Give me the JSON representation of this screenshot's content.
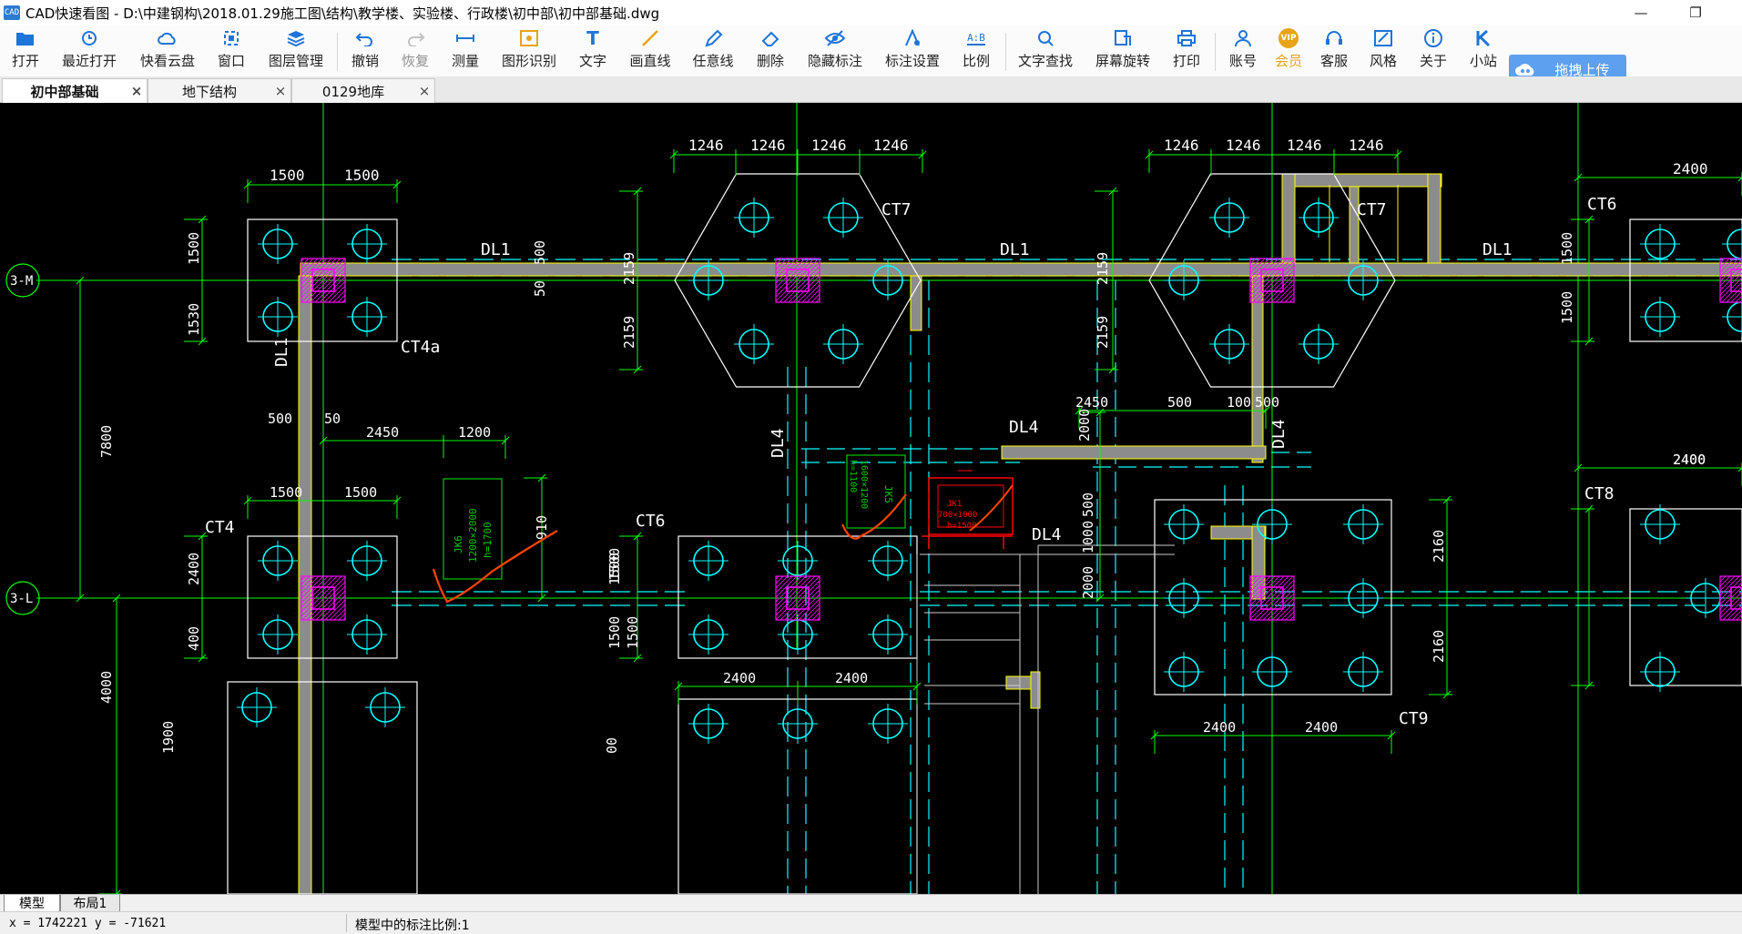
{
  "window": {
    "app_icon_text": "CAD",
    "title": "CAD快速看图 - D:\\中建钢构\\2018.01.29施工图\\结构\\教学楼、实验楼、行政楼\\初中部\\初中部基础.dwg",
    "minimize_glyph": "—",
    "restore_glyph": "❐"
  },
  "toolbar": {
    "items": [
      {
        "label": "打开",
        "icon": "folder-icon"
      },
      {
        "label": "最近打开",
        "icon": "history-icon"
      },
      {
        "label": "快看云盘",
        "icon": "cloud-icon"
      },
      {
        "label": "窗口",
        "icon": "window-icon"
      },
      {
        "label": "图层管理",
        "icon": "layers-icon"
      },
      {
        "label": "撤销",
        "icon": "undo-icon"
      },
      {
        "label": "恢复",
        "icon": "redo-icon"
      },
      {
        "label": "测量",
        "icon": "measure-icon"
      },
      {
        "label": "图形识别",
        "icon": "recognize-icon"
      },
      {
        "label": "文字",
        "icon": "text-icon"
      },
      {
        "label": "画直线",
        "icon": "line-icon"
      },
      {
        "label": "任意线",
        "icon": "pen-icon"
      },
      {
        "label": "删除",
        "icon": "eraser-icon"
      },
      {
        "label": "隐藏标注",
        "icon": "eye-hide-icon"
      },
      {
        "label": "标注设置",
        "icon": "annotation-settings-icon"
      },
      {
        "label": "比例",
        "icon": "scale-icon"
      },
      {
        "label": "文字查找",
        "icon": "text-search-icon"
      },
      {
        "label": "屏幕旋转",
        "icon": "rotate-icon"
      },
      {
        "label": "打印",
        "icon": "print-icon"
      },
      {
        "label": "账号",
        "icon": "user-icon"
      },
      {
        "label": "会员",
        "icon": "vip-icon"
      },
      {
        "label": "客服",
        "icon": "headset-icon"
      },
      {
        "label": "风格",
        "icon": "style-icon"
      },
      {
        "label": "关于",
        "icon": "info-icon"
      },
      {
        "label": "小站",
        "icon": "k-station-icon"
      }
    ],
    "vip_badge": "VIP",
    "text_icon_glyph": "T",
    "scale_icon_glyph": "A:B",
    "upload_label": "拖拽上传",
    "colors": {
      "accent": "#1e74d8",
      "vip": "#e8a317",
      "upload_bg": "#5ea0f0"
    }
  },
  "tabs": [
    {
      "label": "初中部基础",
      "active": true
    },
    {
      "label": "地下结构",
      "active": false
    },
    {
      "label": "0129地库",
      "active": false
    }
  ],
  "tab_close_glyph": "×",
  "drawing": {
    "axis_labels": [
      "3-M",
      "3-L"
    ],
    "pile_cap_labels": [
      "CT7",
      "CT7",
      "CT6",
      "CT4a",
      "CT4",
      "CT6",
      "CT8",
      "CT9"
    ],
    "beam_labels": [
      "DL1",
      "DL1",
      "DL1",
      "DL1",
      "DL4",
      "DL4",
      "DL4",
      "DL4"
    ],
    "dimensions_top": [
      "1246",
      "1246",
      "1246",
      "1246",
      "1246",
      "1246",
      "1246",
      "1246",
      "1500",
      "1500",
      "2400"
    ],
    "dimensions_misc": [
      "1500",
      "1530",
      "500",
      "50",
      "2159",
      "2159",
      "2159",
      "2159",
      "1500",
      "1500",
      "7800",
      "500",
      "50",
      "2450",
      "1200",
      "1500",
      "1500",
      "2400",
      "400",
      "2450",
      "500",
      "100",
      "500",
      "2000",
      "500",
      "1000",
      "2000",
      "910",
      "1500",
      "1500",
      "4000",
      "1500",
      "1500",
      "2400",
      "2400",
      "2400",
      "2400",
      "2160",
      "2160",
      "2400",
      "2400",
      "1900",
      "00"
    ],
    "pit_labels": [
      {
        "name": "JK6",
        "size": "1200×2000",
        "depth": "h=1700"
      },
      {
        "name": "JK5",
        "size": "1600×1200",
        "depth": "h=1100"
      },
      {
        "name": "JK1",
        "size": "700×1000",
        "depth": "h=1500"
      }
    ],
    "colors": {
      "background": "#000000",
      "axis": "#00ff00",
      "pile": "#00ffff",
      "cap_outline": "#ffffff",
      "beam_fill": "#8c8c8c",
      "beam_edge": "#ffff00",
      "column": "#ff00ff",
      "dimension": "#00ff00",
      "pit": "#00c800",
      "markup": "#ff4400",
      "red_detail": "#ff0000"
    }
  },
  "layout_tabs": [
    {
      "label": "模型",
      "active": true
    },
    {
      "label": "布局1",
      "active": false
    }
  ],
  "status": {
    "coords": "x = 1742221  y = -71621",
    "scale_text": "模型中的标注比例:1"
  }
}
